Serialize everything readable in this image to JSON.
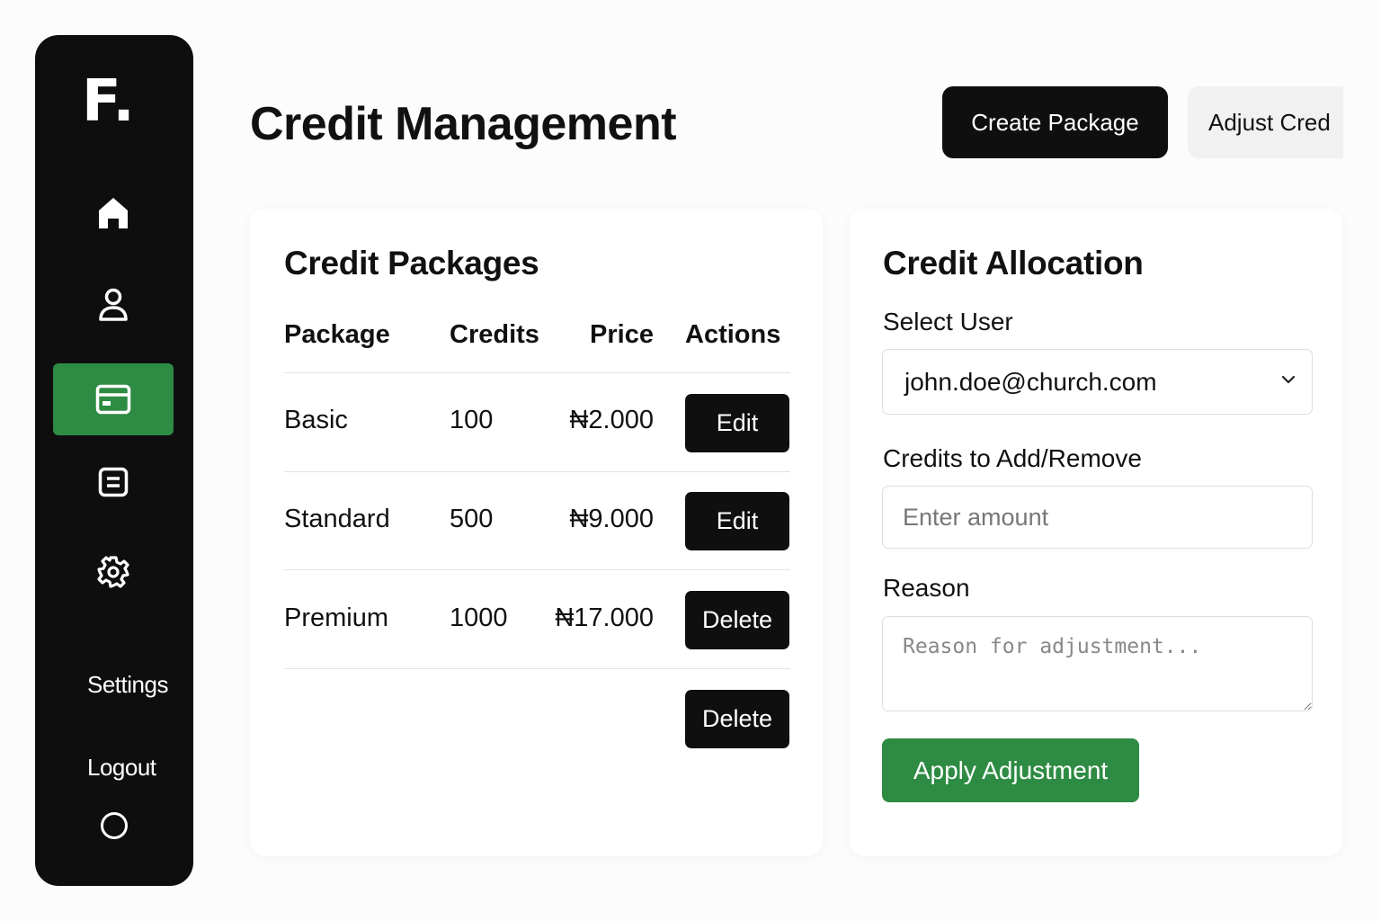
{
  "sidebar": {
    "logo": "F.",
    "items": [
      {
        "icon": "home-icon"
      },
      {
        "icon": "user-icon"
      },
      {
        "icon": "credit-card-icon",
        "active": true
      },
      {
        "icon": "document-icon"
      },
      {
        "icon": "gear-icon"
      }
    ],
    "settings_label": "Settings",
    "logout_label": "Logout",
    "bottom_icon": "circle-icon"
  },
  "header": {
    "title": "Credit Management",
    "create_package_label": "Create Package",
    "adjust_credits_label": "Adjust Cred"
  },
  "packages": {
    "title": "Credit Packages",
    "columns": [
      "Package",
      "Credits",
      "Price",
      "Actions"
    ],
    "rows": [
      {
        "name": "Basic",
        "credits": "100",
        "price": "₦2.000",
        "action": "Edit"
      },
      {
        "name": "Standard",
        "credits": "500",
        "price": "₦9.000",
        "action": "Edit"
      },
      {
        "name": "Premium",
        "credits": "1000",
        "price": "₦17.000",
        "action": "Delete"
      }
    ],
    "extra_action": "Delete"
  },
  "allocation": {
    "title": "Credit Allocation",
    "select_user_label": "Select User",
    "selected_user": "john.doe@church.com",
    "credits_label": "Credits to Add/Remove",
    "credits_placeholder": "Enter amount",
    "reason_label": "Reason",
    "reason_placeholder": "Reason for adjustment...",
    "apply_label": "Apply Adjustment"
  },
  "colors": {
    "accent_green": "#2e8b43",
    "sidebar_bg": "#0e0e0e",
    "button_dark": "#0f0f0f"
  }
}
